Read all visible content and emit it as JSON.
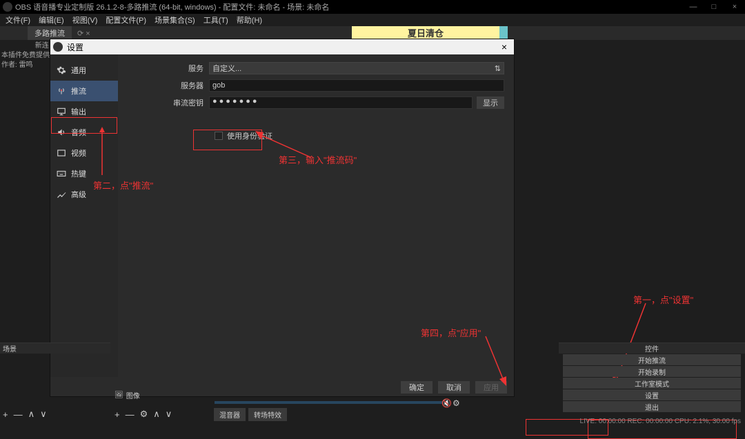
{
  "titlebar": {
    "text": "OBS 语音播专业定制版 26.1.2-8-多路推流 (64-bit, windows) - 配置文件: 未命名 - 场景: 未命名",
    "min": "—",
    "max": "□",
    "close": "×"
  },
  "menubar": [
    "文件(F)",
    "编辑(E)",
    "视图(V)",
    "配置文件(P)",
    "场景集合(S)",
    "工具(T)",
    "帮助(H)"
  ],
  "dock": {
    "tab": "多路推流",
    "icons": "⟳  ×"
  },
  "side_note": {
    "prefix": "新连",
    "line1": "本插件免费提供,",
    "line2": "作者: 雷鸣"
  },
  "banner": "夏日清仓",
  "dialog": {
    "title": "设置",
    "close": "×",
    "sidebar": [
      {
        "label": "通用",
        "icon": "gear"
      },
      {
        "label": "推流",
        "icon": "broadcast"
      },
      {
        "label": "输出",
        "icon": "monitor"
      },
      {
        "label": "音频",
        "icon": "speaker"
      },
      {
        "label": "视频",
        "icon": "video"
      },
      {
        "label": "热键",
        "icon": "keyboard"
      },
      {
        "label": "高级",
        "icon": "tools"
      }
    ],
    "form": {
      "service_label": "服务",
      "service_value": "自定义...",
      "server_label": "服务器",
      "server_value": "gob",
      "key_label": "串流密钥",
      "key_value": "●●●●●●●",
      "show": "显示",
      "auth": "使用身份验证"
    },
    "buttons": {
      "ok": "确定",
      "cancel": "取消",
      "apply": "应用"
    }
  },
  "annotations": {
    "step1": "第一，点\"设置\"",
    "step2": "第二，点\"推流\"",
    "step3": "第三，输入\"推流码\"",
    "step4": "第四，点\"应用\""
  },
  "controls": {
    "header": "控件",
    "items": [
      "开始推流",
      "开始录制",
      "工作室模式",
      "设置",
      "退出"
    ]
  },
  "scene_header": "场景",
  "sources": {
    "item": "图像"
  },
  "mixer": {
    "tab1": "混音器",
    "tab2": "转场特效"
  },
  "toolbar": {
    "plus": "+",
    "minus": "—",
    "up": "∧",
    "down": "∨",
    "gear": "⚙"
  },
  "mute_icon": "🔇",
  "status": "LIVE: 00:00:00    REC: 00:00:00    CPU: 2.1%, 30.00 fps"
}
